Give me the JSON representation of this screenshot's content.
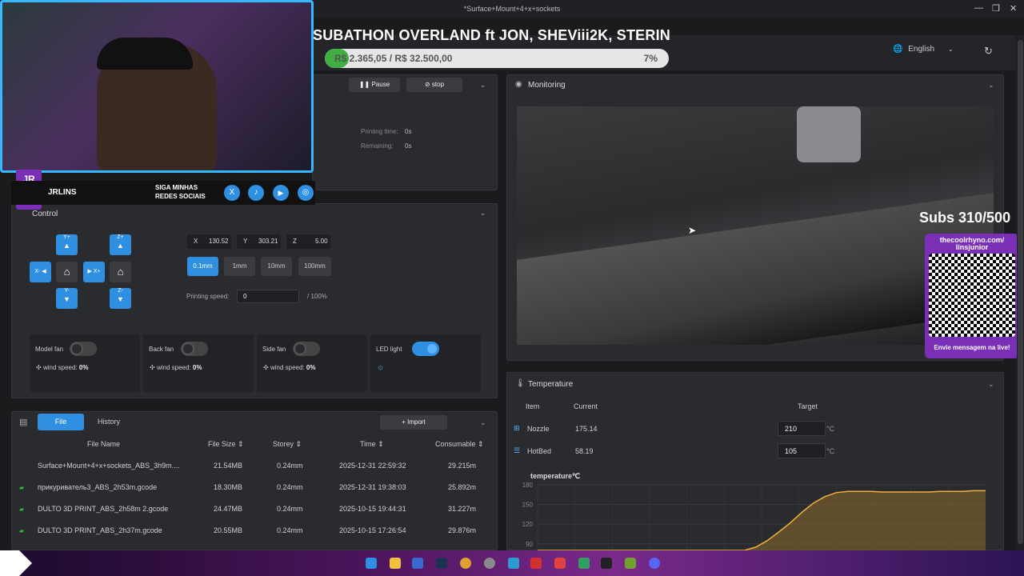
{
  "window": {
    "title": "*Surface+Mount+4+x+sockets"
  },
  "overlay": {
    "subathon_title": "SUBATHON OVERLAND ft JON, SHEViii2K, STERIN",
    "goal_text": "R$ 2.365,05 / R$ 32.500,00",
    "goal_percent": "7%",
    "goal_fraction": 0.07,
    "streamer_name": "JRLINS",
    "social_text_1": "SIGA MINHAS",
    "social_text_2": "REDES SOCIAIS",
    "subs_counter": "Subs 310/500",
    "qr_url_1": "thecoolrhyno.com/",
    "qr_url_2": "linsjunior",
    "qr_caption": "Envie mensagem na live!"
  },
  "header": {
    "language": "English"
  },
  "print_status": {
    "pause_label": "Pause",
    "stop_label": "stop",
    "printing_time_label": "Printing time:",
    "printing_time_value": "0s",
    "remaining_label": "Remaining:",
    "remaining_value": "0s"
  },
  "control": {
    "title": "Control",
    "jog": {
      "y_plus": "Y+",
      "y_minus": "Y-",
      "x_minus": "X-",
      "x_plus": "X+",
      "z_plus": "Z+",
      "z_minus": "Z-"
    },
    "coords": {
      "x_label": "X",
      "x_value": "130.52",
      "y_label": "Y",
      "y_value": "303.21",
      "z_label": "Z",
      "z_value": "5.00"
    },
    "steps": [
      "0.1mm",
      "1mm",
      "10mm",
      "100mm"
    ],
    "printing_speed_label": "Printing speed:",
    "printing_speed_value": "0",
    "printing_speed_suffix": "/ 100%",
    "fans": [
      {
        "label": "Model fan",
        "wind_label": "wind speed:",
        "wind_value": "0%"
      },
      {
        "label": "Back fan",
        "wind_label": "wind speed:",
        "wind_value": "0%"
      },
      {
        "label": "Side fan",
        "wind_label": "wind speed:",
        "wind_value": "0%"
      }
    ],
    "led_label": "LED light"
  },
  "files": {
    "tab_file": "File",
    "tab_history": "History",
    "import_label": "Import",
    "columns": [
      "File Name",
      "File Size",
      "Storey",
      "Time",
      "Consumable"
    ],
    "rows": [
      {
        "name": "Surface+Mount+4+x+sockets_ABS_3h9m....",
        "size": "21.54MB",
        "storey": "0.24mm",
        "time": "2025-12-31 22:59:32",
        "consumable": "29.215m"
      },
      {
        "name": "прикуриватель3_ABS_2h53m.gcode",
        "size": "18.30MB",
        "storey": "0.24mm",
        "time": "2025-12-31 19:38:03",
        "consumable": "25.892m"
      },
      {
        "name": "DULTO 3D PRINT_ABS_2h58m 2.gcode",
        "size": "24.47MB",
        "storey": "0.24mm",
        "time": "2025-10-15 19:44:31",
        "consumable": "31.227m"
      },
      {
        "name": "DULTO 3D PRINT_ABS_2h37m.gcode",
        "size": "20.55MB",
        "storey": "0.24mm",
        "time": "2025-10-15 17:26:54",
        "consumable": "29.876m"
      }
    ]
  },
  "monitoring": {
    "title": "Monitoring"
  },
  "temperature": {
    "title": "Temperature",
    "col_item": "Item",
    "col_current": "Current",
    "col_target": "Target",
    "rows": [
      {
        "item": "Nozzle",
        "current": "175.14",
        "target": "210",
        "unit": "°C"
      },
      {
        "item": "HotBed",
        "current": "58.19",
        "target": "105",
        "unit": "°C"
      }
    ],
    "chart_title": "temperature℃"
  },
  "chart_data": {
    "type": "area",
    "title": "temperature℃",
    "yticks": [
      180,
      150,
      120,
      90
    ],
    "ylim": [
      80,
      180
    ],
    "series": [
      {
        "values": [
          80,
          80,
          80,
          80,
          80,
          80,
          80,
          80,
          80,
          80,
          80,
          80,
          80,
          80,
          80,
          80,
          80,
          80,
          80,
          85,
          95,
          108,
          122,
          138,
          152,
          162,
          168,
          170,
          170,
          170,
          169,
          169,
          169,
          169,
          169,
          170,
          170,
          170,
          171,
          171
        ]
      }
    ]
  }
}
